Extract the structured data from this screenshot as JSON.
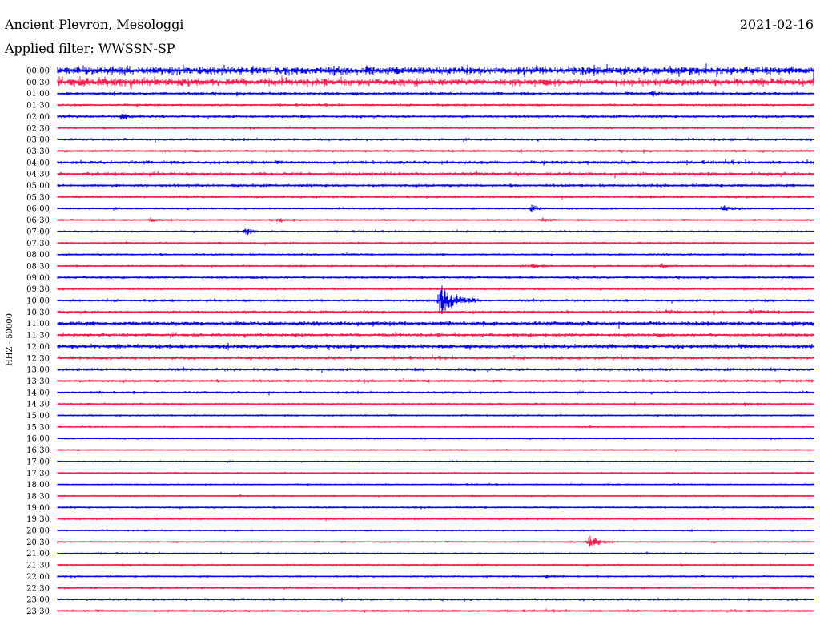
{
  "header": {
    "station": "Ancient Plevron, Mesologgi",
    "date": "2021-02-16",
    "filter": "Applied filter: WWSSN-SP"
  },
  "chart_data": {
    "type": "line",
    "title": "",
    "ylabel": "HHZ - 50000",
    "colors": {
      "even_rows": "#0000ee",
      "odd_rows": "#ff1a4b",
      "background": "#ffffff"
    },
    "grid": false,
    "row_labels": [
      "00:00",
      "00:30",
      "01:00",
      "01:30",
      "02:00",
      "02:30",
      "03:00",
      "03:30",
      "04:00",
      "04:30",
      "05:00",
      "05:30",
      "06:00",
      "06:30",
      "07:00",
      "07:30",
      "08:00",
      "08:30",
      "09:00",
      "09:30",
      "10:00",
      "10:30",
      "11:00",
      "11:30",
      "12:00",
      "12:30",
      "13:00",
      "13:30",
      "14:00",
      "14:30",
      "15:00",
      "15:30",
      "16:00",
      "16:30",
      "17:00",
      "17:30",
      "18:00",
      "18:30",
      "19:00",
      "19:30",
      "20:00",
      "20:30",
      "21:00",
      "21:30",
      "22:00",
      "22:30",
      "23:00",
      "23:30"
    ],
    "noise_level": [
      2.2,
      1.8,
      0.6,
      0.5,
      0.5,
      0.35,
      0.5,
      0.5,
      0.75,
      0.75,
      0.55,
      0.4,
      0.35,
      0.35,
      0.35,
      0.35,
      0.35,
      0.35,
      0.45,
      0.4,
      0.5,
      0.55,
      0.9,
      0.8,
      1.0,
      0.7,
      0.6,
      0.55,
      0.45,
      0.35,
      0.3,
      0.25,
      0.25,
      0.25,
      0.25,
      0.25,
      0.25,
      0.25,
      0.3,
      0.3,
      0.3,
      0.3,
      0.3,
      0.3,
      0.3,
      0.35,
      0.45,
      0.45
    ],
    "events": [
      {
        "row": 1,
        "minute": 0.5,
        "amplitude": 1.2,
        "duration": 11.0
      },
      {
        "row": 2,
        "minute": 23.6,
        "amplitude": 1.8,
        "duration": 0.9
      },
      {
        "row": 2,
        "minute": 25.1,
        "amplitude": 0.9,
        "duration": 0.6
      },
      {
        "row": 4,
        "minute": 2.6,
        "amplitude": 2.1,
        "duration": 0.9
      },
      {
        "row": 6,
        "minute": 30.4,
        "amplitude": 1.0,
        "duration": 0.6
      },
      {
        "row": 12,
        "minute": 18.8,
        "amplitude": 2.5,
        "duration": 0.7
      },
      {
        "row": 12,
        "minute": 26.4,
        "amplitude": 1.2,
        "duration": 1.4
      },
      {
        "row": 13,
        "minute": 3.7,
        "amplitude": 1.4,
        "duration": 0.5
      },
      {
        "row": 13,
        "minute": 8.8,
        "amplitude": 1.4,
        "duration": 0.5
      },
      {
        "row": 13,
        "minute": 19.3,
        "amplitude": 1.2,
        "duration": 0.5
      },
      {
        "row": 14,
        "minute": 7.5,
        "amplitude": 2.6,
        "duration": 0.5
      },
      {
        "row": 17,
        "minute": 18.8,
        "amplitude": 1.6,
        "duration": 0.8
      },
      {
        "row": 17,
        "minute": 24.0,
        "amplitude": 1.2,
        "duration": 0.7
      },
      {
        "row": 20,
        "minute": 15.2,
        "amplitude": 13.0,
        "duration": 1.5
      },
      {
        "row": 21,
        "minute": 24.2,
        "amplitude": 0.9,
        "duration": 1.5
      },
      {
        "row": 21,
        "minute": 27.5,
        "amplitude": 0.8,
        "duration": 1.5
      },
      {
        "row": 29,
        "minute": 27.3,
        "amplitude": 0.9,
        "duration": 0.6
      },
      {
        "row": 41,
        "minute": 21.1,
        "amplitude": 4.4,
        "duration": 1.0
      },
      {
        "row": 44,
        "minute": 19.4,
        "amplitude": 0.8,
        "duration": 0.4
      }
    ]
  }
}
